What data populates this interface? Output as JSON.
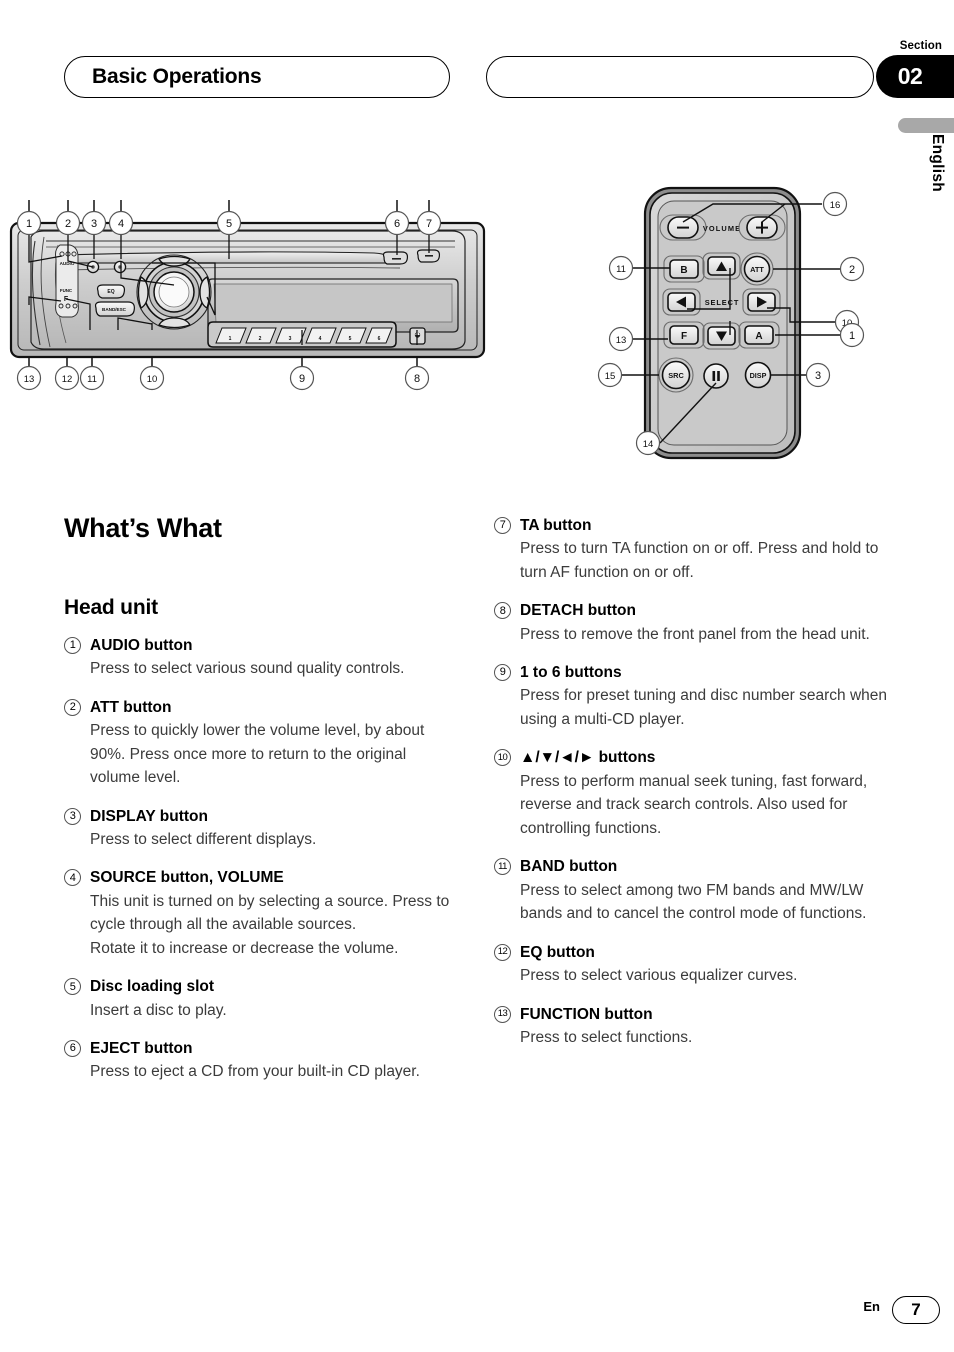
{
  "header": {
    "left_title": "Basic Operations",
    "right_title": "",
    "section_label": "Section",
    "section_number": "02",
    "language": "English"
  },
  "headings": {
    "main": "What’s What",
    "sub": "Head unit"
  },
  "entries": [
    {
      "num": "1",
      "title": "AUDIO button",
      "body": "Press to select various sound quality controls."
    },
    {
      "num": "2",
      "title": "ATT button",
      "body": "Press to quickly lower the volume level, by about 90%. Press once more to return to the original volume level."
    },
    {
      "num": "3",
      "title": "DISPLAY button",
      "body": "Press to select different displays."
    },
    {
      "num": "4",
      "title": "SOURCE button, VOLUME",
      "body": "This unit is turned on by selecting a source. Press to cycle through all the available sources.\nRotate it to increase or decrease the volume."
    },
    {
      "num": "5",
      "title": "Disc loading slot",
      "body": "Insert a disc to play."
    },
    {
      "num": "6",
      "title": "EJECT button",
      "body": "Press to eject a CD from your built-in CD player."
    },
    {
      "num": "7",
      "title": "TA button",
      "body": "Press to turn TA function on or off. Press and hold to turn AF function on or off."
    },
    {
      "num": "8",
      "title": "DETACH button",
      "body": "Press to remove the front panel from the head unit."
    },
    {
      "num": "9",
      "title": "1 to 6 buttons",
      "body": "Press for preset tuning and disc number search when using a multi-CD player."
    },
    {
      "num": "10",
      "title": "▲/▼/◄/► buttons",
      "body": "Press to perform manual seek tuning, fast forward, reverse and track search controls. Also used for controlling functions."
    },
    {
      "num": "11",
      "title": "BAND button",
      "body": "Press to select among two FM bands and MW/LW bands and to cancel the control mode of functions."
    },
    {
      "num": "12",
      "title": "EQ button",
      "body": "Press to select various equalizer curves."
    },
    {
      "num": "13",
      "title": "FUNCTION button",
      "body": "Press to select functions."
    }
  ],
  "head_unit_diagram": {
    "callouts_top": [
      "1",
      "2",
      "3",
      "4",
      "5",
      "6",
      "7"
    ],
    "callouts_bottom": [
      "13",
      "12",
      "11",
      "10",
      "9",
      "8"
    ],
    "face_labels": [
      "AUDIO",
      "FUNC",
      "F",
      "EQ",
      "BAND/ESC"
    ],
    "preset_buttons": [
      "1",
      "2",
      "3",
      "4",
      "5",
      "6"
    ]
  },
  "remote_diagram": {
    "volume_label": "VOLUME",
    "select_label": "SELECT",
    "buttons": [
      {
        "label": "−",
        "callout": "16"
      },
      {
        "label": "+",
        "callout": "16"
      },
      {
        "label": "B",
        "callout": "11"
      },
      {
        "label": "▲",
        "callout": "10"
      },
      {
        "label": "ATT",
        "callout": "2"
      },
      {
        "label": "◄",
        "callout": "10"
      },
      {
        "label": "►",
        "callout": "10"
      },
      {
        "label": "F",
        "callout": "13"
      },
      {
        "label": "▼",
        "callout": "10"
      },
      {
        "label": "A",
        "callout": "1"
      },
      {
        "label": "SRC",
        "callout": "15"
      },
      {
        "label": "Ⅱ",
        "callout": "14"
      },
      {
        "label": "DISP",
        "callout": "3"
      }
    ],
    "callouts": [
      "16",
      "11",
      "2",
      "10",
      "13",
      "1",
      "15",
      "3",
      "14"
    ]
  },
  "footer": {
    "lang_code": "En",
    "page_number": "7"
  },
  "colors": {
    "panel_fill": "#cfcfcf",
    "panel_light": "#e3e3e3",
    "panel_dark": "#9a9a9a",
    "ink": "#000000",
    "body_text": "#3b3b3b",
    "lang_bar": "#a8a8a8"
  }
}
